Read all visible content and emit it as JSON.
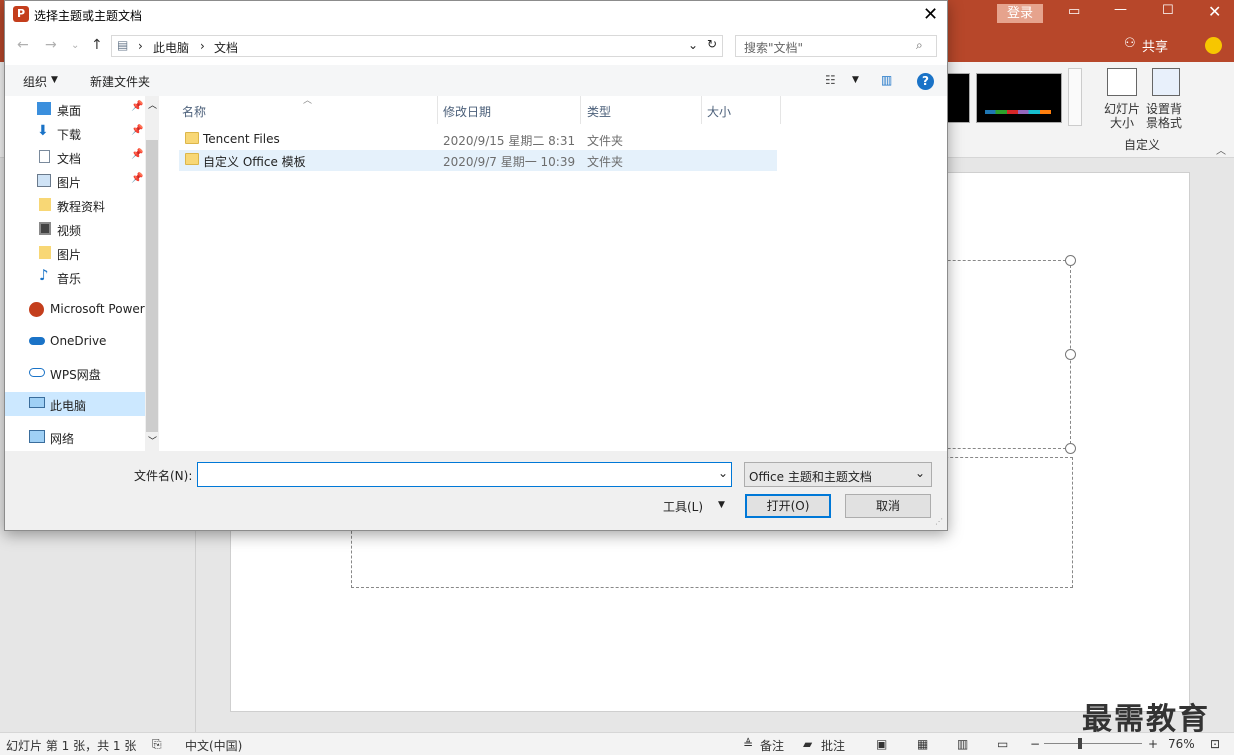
{
  "ppt": {
    "login_label": "登录",
    "share_label": "共享",
    "ribbon": {
      "slide_size_line1": "幻灯片",
      "slide_size_line2": "大小",
      "format_bg_line1": "设置背",
      "format_bg_line2": "景格式",
      "group_label": "自定义"
    },
    "statusbar": {
      "slide_info": "幻灯片 第 1 张，共 1 张",
      "language": "中文(中国)",
      "notes_label": "备注",
      "comments_label": "批注",
      "zoom": "76%"
    },
    "watermark": "最需教育",
    "colors": {
      "titlebar": "#b7472a",
      "ribbon": "#f3f3f3"
    }
  },
  "dialog": {
    "title": "选择主题或主题文档",
    "app_icon_letter": "P",
    "address": {
      "segment1": "此电脑",
      "segment2": "文档"
    },
    "search_placeholder": "搜索\"文档\"",
    "toolbar": {
      "organize": "组织",
      "new_folder": "新建文件夹"
    },
    "nav_items": [
      {
        "label": "桌面",
        "pinned": true
      },
      {
        "label": "下载",
        "pinned": true
      },
      {
        "label": "文档",
        "pinned": true
      },
      {
        "label": "图片",
        "pinned": true
      },
      {
        "label": "教程资料",
        "pinned": false
      },
      {
        "label": "视频",
        "pinned": false
      },
      {
        "label": "图片",
        "pinned": false
      },
      {
        "label": "音乐",
        "pinned": false
      },
      {
        "label": "Microsoft Power"
      },
      {
        "label": "OneDrive"
      },
      {
        "label": "WPS网盘"
      },
      {
        "label": "此电脑"
      },
      {
        "label": "网络"
      }
    ],
    "columns": {
      "name": "名称",
      "modified": "修改日期",
      "type": "类型",
      "size": "大小"
    },
    "files": [
      {
        "name": "Tencent Files",
        "modified": "2020/9/15 星期二 8:31",
        "type": "文件夹"
      },
      {
        "name": "自定义 Office 模板",
        "modified": "2020/9/7 星期一 10:39",
        "type": "文件夹"
      }
    ],
    "filename_label": "文件名(N):",
    "filename_value": "",
    "filetype_value": "Office 主题和主题文档",
    "tools_label": "工具(L)",
    "open_label": "打开(O)",
    "cancel_label": "取消"
  }
}
